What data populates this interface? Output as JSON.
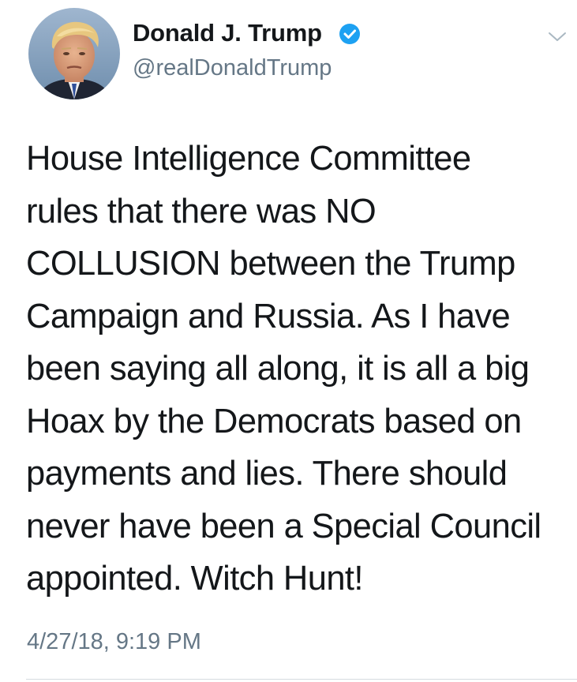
{
  "author": {
    "display_name": "Donald J. Trump",
    "handle": "@realDonaldTrump",
    "verified": true,
    "verified_color": "#1da1f2"
  },
  "icons": {
    "avatar": "profile-photo",
    "verified": "verified-badge-icon",
    "menu": "chevron-down-icon"
  },
  "tweet": {
    "lines": [
      "House Intelligence Committee",
      "rules that there was NO",
      "COLLUSION between the Trump",
      "Campaign and Russia. As I have",
      "been saying all along, it is all a big",
      "Hoax by the Democrats based on",
      "payments and lies. There should",
      "never have been a Special Council",
      "appointed. Witch Hunt!"
    ],
    "timestamp": "4/27/18, 9:19 PM"
  },
  "colors": {
    "text": "#14171a",
    "secondary": "#657786",
    "divider": "#d6dbdf"
  }
}
